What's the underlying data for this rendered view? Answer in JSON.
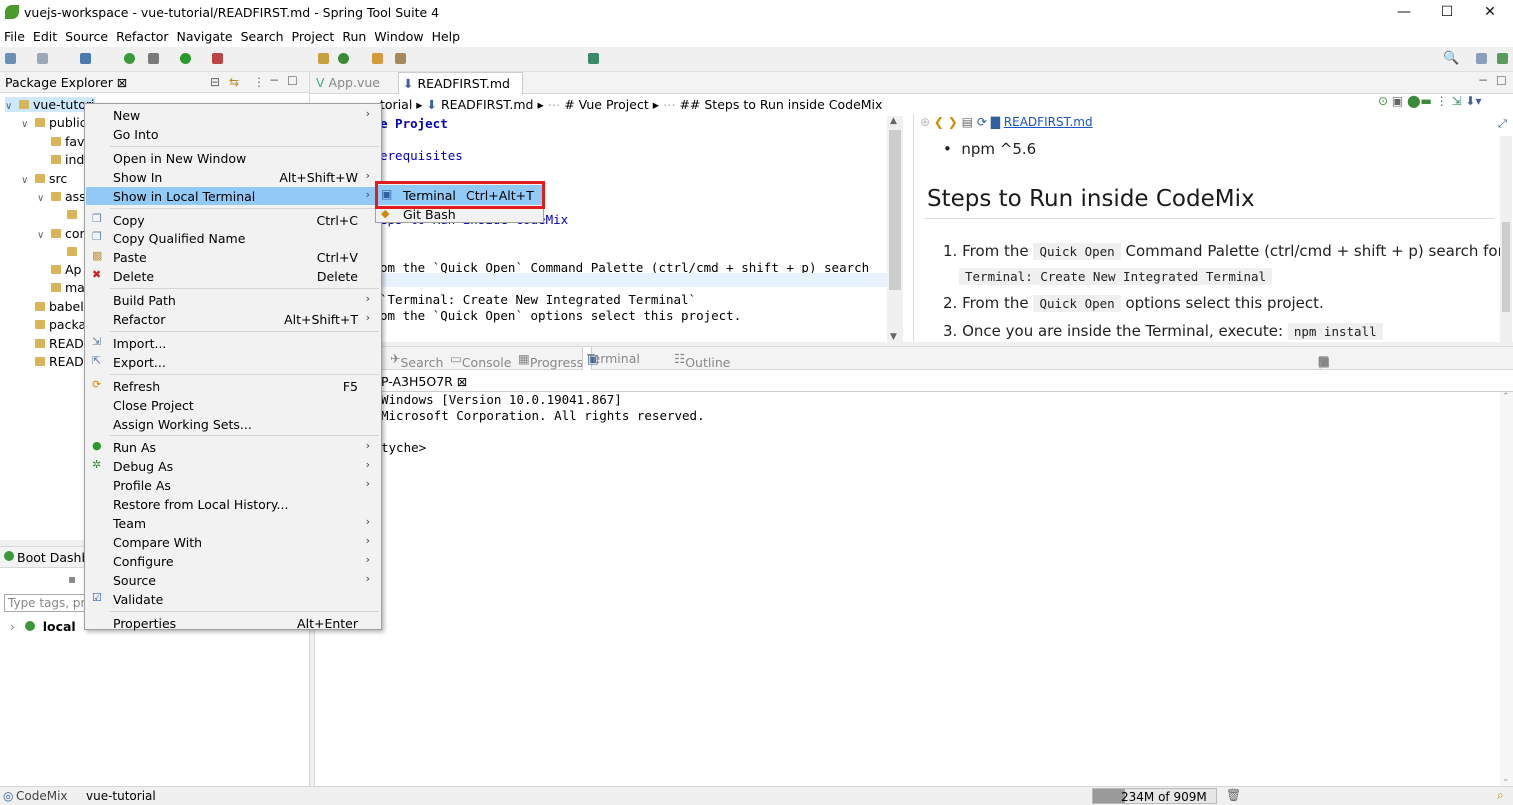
{
  "window": {
    "title": "vuejs-workspace - vue-tutorial/READFIRST.md - Spring Tool Suite 4",
    "min": "—",
    "max": "☐",
    "close": "✕"
  },
  "menubar": [
    "File",
    "Edit",
    "Source",
    "Refactor",
    "Navigate",
    "Search",
    "Project",
    "Run",
    "Window",
    "Help"
  ],
  "package_explorer": {
    "tab": "Package Explorer ⊠",
    "tree": [
      {
        "label": "vue-tutori",
        "indent": 0,
        "chev": "∨"
      },
      {
        "label": "public",
        "indent": 1,
        "chev": "∨"
      },
      {
        "label": "fav",
        "indent": 2,
        "chev": ""
      },
      {
        "label": "ind",
        "indent": 2,
        "chev": ""
      },
      {
        "label": "src",
        "indent": 1,
        "chev": "∨"
      },
      {
        "label": "ass",
        "indent": 2,
        "chev": "∨"
      },
      {
        "label": "",
        "indent": 3,
        "chev": ""
      },
      {
        "label": "cor",
        "indent": 2,
        "chev": "∨"
      },
      {
        "label": "",
        "indent": 3,
        "chev": ""
      },
      {
        "label": "Ap",
        "indent": 2,
        "chev": ""
      },
      {
        "label": "ma",
        "indent": 2,
        "chev": ""
      },
      {
        "label": "babel.",
        "indent": 1,
        "chev": ""
      },
      {
        "label": "packa",
        "indent": 1,
        "chev": ""
      },
      {
        "label": "READ",
        "indent": 1,
        "chev": ""
      },
      {
        "label": "READ",
        "indent": 1,
        "chev": ""
      }
    ]
  },
  "boot_dashboard": {
    "tab": "Boot Dashb",
    "filter_placeholder": "Type tags, pro",
    "local": "local"
  },
  "editor": {
    "tabs": [
      "App.vue",
      "READFIRST.md ⊠"
    ],
    "breadcrumb": [
      "torial",
      "READFIRST.md",
      "# Vue Project",
      "## Steps to Run inside CodeMix"
    ],
    "lines": [
      "e Project",
      "",
      "erequisites",
      "",
      "",
      "",
      "eps to Run inside CodeMix",
      "",
      "",
      "om the `Quick Open`  Command Palette (ctrl/cmd + shift + p) search",
      "",
      "`Terminal: Create New Integrated Terminal`",
      "om the `Quick Open` options select this project."
    ]
  },
  "preview": {
    "link": "READFIRST.md",
    "bullet": "npm ^5.6",
    "heading": "Steps to Run inside CodeMix",
    "items": [
      {
        "n": "1.",
        "pre": "From the",
        "code": "Quick Open",
        "post": "Command Palette (ctrl/cmd + shift + p) search for:"
      },
      {
        "n": "",
        "pre": "",
        "code": "Terminal: Create New Integrated Terminal",
        "post": ""
      },
      {
        "n": "2.",
        "pre": "From the",
        "code": "Quick Open",
        "post": "options select this project."
      },
      {
        "n": "3.",
        "pre": "Once you are inside the Terminal, execute:",
        "code": "npm install",
        "post": ""
      }
    ]
  },
  "views": {
    "tabs": [
      "Search",
      "Console",
      "Progress",
      "Terminal ⊠",
      "Outline"
    ]
  },
  "terminal": {
    "tab": "P-A3H5O7R ⊠",
    "lines": [
      " Windows [Version 10.0.19041.867]",
      "Microsoft Corporation. All rights reserved.",
      "",
      "tyche>"
    ]
  },
  "context_menu": [
    {
      "label": "New",
      "shortcut": "",
      "arrow": true,
      "icon": ""
    },
    {
      "label": "Go Into",
      "shortcut": "",
      "arrow": false,
      "icon": ""
    },
    {
      "sep": true
    },
    {
      "label": "Open in New Window",
      "shortcut": "",
      "arrow": false,
      "icon": ""
    },
    {
      "label": "Show In",
      "shortcut": "Alt+Shift+W",
      "arrow": true,
      "icon": ""
    },
    {
      "label": "Show in Local Terminal",
      "shortcut": "",
      "arrow": true,
      "icon": "",
      "hl": true
    },
    {
      "sep": true
    },
    {
      "label": "Copy",
      "shortcut": "Ctrl+C",
      "arrow": false,
      "icon": "copy"
    },
    {
      "label": "Copy Qualified Name",
      "shortcut": "",
      "arrow": false,
      "icon": "copy"
    },
    {
      "label": "Paste",
      "shortcut": "Ctrl+V",
      "arrow": false,
      "icon": "paste"
    },
    {
      "label": "Delete",
      "shortcut": "Delete",
      "arrow": false,
      "icon": "delete"
    },
    {
      "sep": true
    },
    {
      "label": "Build Path",
      "shortcut": "",
      "arrow": true,
      "icon": ""
    },
    {
      "label": "Refactor",
      "shortcut": "Alt+Shift+T",
      "arrow": true,
      "icon": ""
    },
    {
      "sep": true
    },
    {
      "label": "Import...",
      "shortcut": "",
      "arrow": false,
      "icon": "import"
    },
    {
      "label": "Export...",
      "shortcut": "",
      "arrow": false,
      "icon": "export"
    },
    {
      "sep": true
    },
    {
      "label": "Refresh",
      "shortcut": "F5",
      "arrow": false,
      "icon": "refresh"
    },
    {
      "label": "Close Project",
      "shortcut": "",
      "arrow": false,
      "icon": ""
    },
    {
      "label": "Assign Working Sets...",
      "shortcut": "",
      "arrow": false,
      "icon": ""
    },
    {
      "sep": true
    },
    {
      "label": "Run As",
      "shortcut": "",
      "arrow": true,
      "icon": "run"
    },
    {
      "label": "Debug As",
      "shortcut": "",
      "arrow": true,
      "icon": "debug"
    },
    {
      "label": "Profile As",
      "shortcut": "",
      "arrow": true,
      "icon": ""
    },
    {
      "label": "Restore from Local History...",
      "shortcut": "",
      "arrow": false,
      "icon": ""
    },
    {
      "label": "Team",
      "shortcut": "",
      "arrow": true,
      "icon": ""
    },
    {
      "label": "Compare With",
      "shortcut": "",
      "arrow": true,
      "icon": ""
    },
    {
      "label": "Configure",
      "shortcut": "",
      "arrow": true,
      "icon": ""
    },
    {
      "label": "Source",
      "shortcut": "",
      "arrow": true,
      "icon": ""
    },
    {
      "label": "Validate",
      "shortcut": "",
      "arrow": false,
      "icon": "check"
    },
    {
      "sep": true
    },
    {
      "label": "Properties",
      "shortcut": "Alt+Enter",
      "arrow": false,
      "icon": ""
    }
  ],
  "submenu": [
    {
      "label": "Terminal",
      "shortcut": "Ctrl+Alt+T"
    },
    {
      "label": "Git Bash",
      "shortcut": ""
    }
  ],
  "statusbar": {
    "codemix": "CodeMix",
    "project": "vue-tutorial",
    "memory": "234M of 909M"
  },
  "colors": {
    "highlight": "#91c9f7",
    "red_box": "#e21d1d",
    "keyword_blue": "#0000c0"
  }
}
